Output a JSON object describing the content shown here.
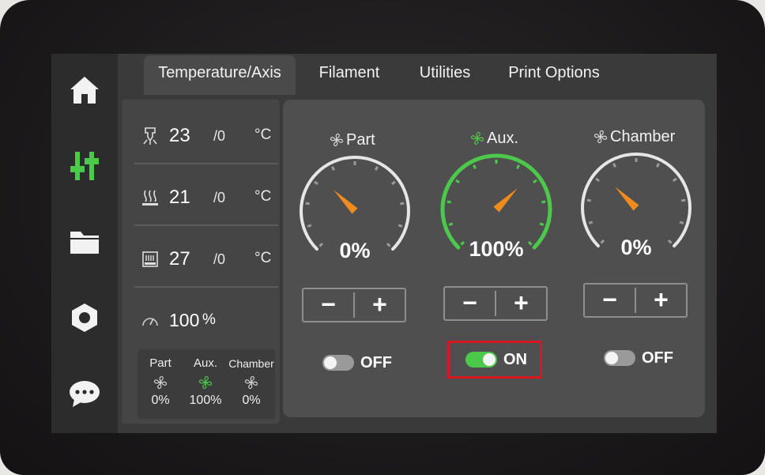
{
  "colors": {
    "accent_green": "#4cc94a",
    "needle_orange": "#f08c1e",
    "highlight_red": "#d9171e",
    "gauge_track": "#e6e6e6"
  },
  "nav": {
    "items": [
      {
        "icon": "home-icon"
      },
      {
        "icon": "control-sliders-icon",
        "active": true
      },
      {
        "icon": "folder-icon"
      },
      {
        "icon": "settings-nut-icon"
      },
      {
        "icon": "chat-bubble-icon"
      }
    ]
  },
  "tabs": [
    {
      "label": "Temperature/Axis",
      "active": true
    },
    {
      "label": "Filament"
    },
    {
      "label": "Utilities"
    },
    {
      "label": "Print Options"
    }
  ],
  "temps": [
    {
      "icon": "nozzle-icon",
      "value": "23",
      "target": "/0",
      "unit": "°C"
    },
    {
      "icon": "heatbed-icon",
      "value": "21",
      "target": "/0",
      "unit": "°C"
    },
    {
      "icon": "chamber-icon",
      "value": "27",
      "target": "/0",
      "unit": "°C"
    }
  ],
  "speed": {
    "icon": "speed-gauge-icon",
    "value": "100",
    "unit": "%"
  },
  "fan_summary": [
    {
      "name": "Part",
      "value": "0%",
      "active": false
    },
    {
      "name": "Aux.",
      "value": "100%",
      "active": true
    },
    {
      "name": "Chamber",
      "value": "0%",
      "active": false
    }
  ],
  "fans": [
    {
      "name": "Part",
      "percent": 0,
      "percent_label": "0%",
      "toggle_label": "OFF",
      "on": false
    },
    {
      "name": "Aux.",
      "percent": 100,
      "percent_label": "100%",
      "toggle_label": "ON",
      "on": true
    },
    {
      "name": "Chamber",
      "percent": 0,
      "percent_label": "0%",
      "toggle_label": "OFF",
      "on": false
    }
  ],
  "stepper": {
    "minus": "−",
    "plus": "+"
  }
}
